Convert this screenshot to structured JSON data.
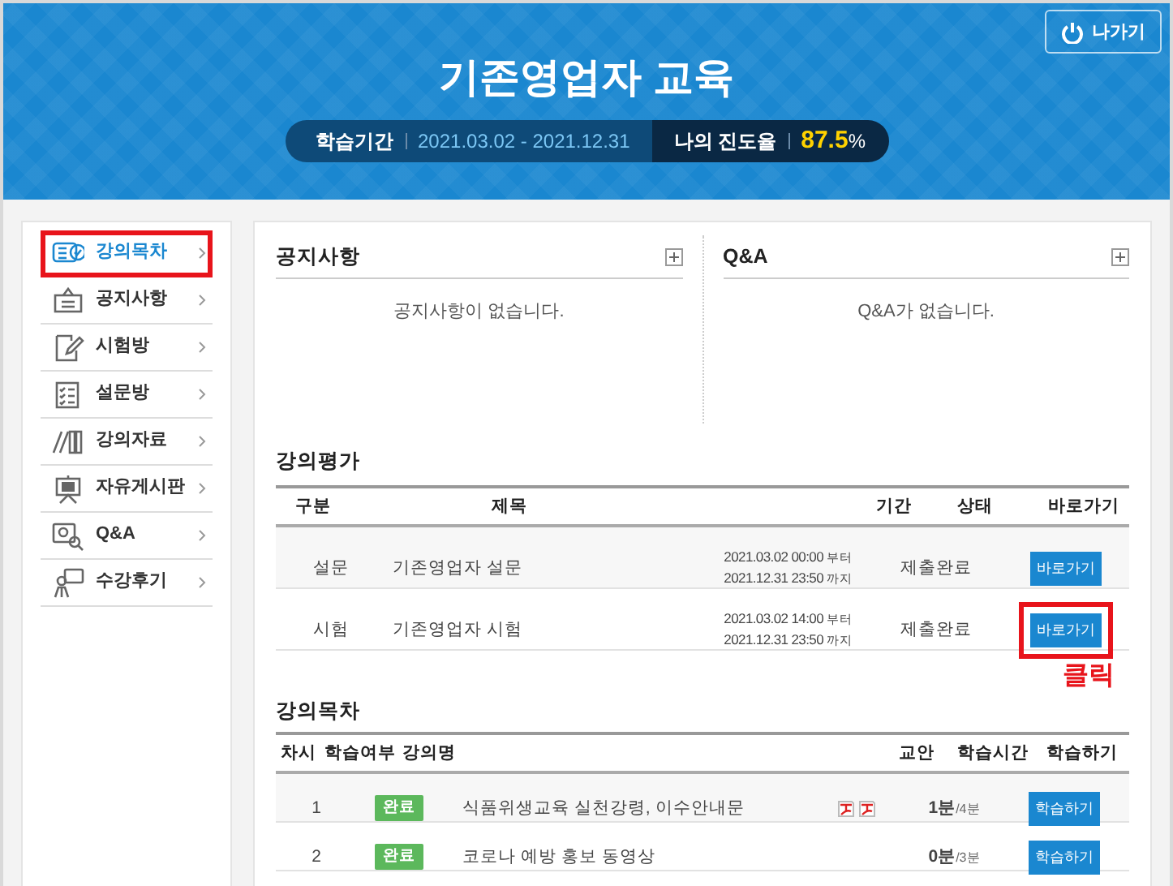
{
  "header": {
    "title": "기존영업자 교육",
    "exit_button": "나가기",
    "period_label": "학습기간",
    "period": "2021.03.02 - 2021.12.31",
    "progress_label": "나의 진도율",
    "progress_value": "87.5",
    "progress_unit": "%"
  },
  "sidebar": {
    "items": [
      {
        "label": "강의목차",
        "kind": "lecture",
        "selected": true,
        "highlighted": true
      },
      {
        "label": "공지사항",
        "kind": "notice",
        "selected": false,
        "highlighted": false
      },
      {
        "label": "시험방",
        "kind": "exam",
        "selected": false,
        "highlighted": false
      },
      {
        "label": "설문방",
        "kind": "survey",
        "selected": false,
        "highlighted": false
      },
      {
        "label": "강의자료",
        "kind": "books",
        "selected": false,
        "highlighted": false
      },
      {
        "label": "자유게시판",
        "kind": "board",
        "selected": false,
        "highlighted": false
      },
      {
        "label": "Q&A",
        "kind": "qna",
        "selected": false,
        "highlighted": false
      },
      {
        "label": "수강후기",
        "kind": "review",
        "selected": false,
        "highlighted": false
      }
    ]
  },
  "panels": [
    {
      "title": "공지사항",
      "empty_text": "공지사항이 없습니다."
    },
    {
      "title": "Q&A",
      "empty_text": "Q&A가 없습니다."
    }
  ],
  "evaluation": {
    "title": "강의평가",
    "columns": [
      "구분",
      "제목",
      "기간",
      "상태",
      "바로가기"
    ],
    "rows": [
      {
        "type": "설문",
        "title": "기존영업자 설문",
        "start": "2021.03.02 00:00",
        "start_suffix": "부터",
        "end": "2021.12.31 23:50",
        "end_suffix": "까지",
        "status": "제출완료",
        "button": "바로가기",
        "highlighted": false
      },
      {
        "type": "시험",
        "title": "기존영업자 시험",
        "start": "2021.03.02 14:00",
        "start_suffix": "부터",
        "end": "2021.12.31 23:50",
        "end_suffix": "까지",
        "status": "제출완료",
        "button": "바로가기",
        "highlighted": true
      }
    ]
  },
  "annotation": "클릭",
  "lessons": {
    "title": "강의목차",
    "columns": [
      "차시",
      "학습여부",
      "강의명",
      "교안",
      "학습시간",
      "학습하기"
    ],
    "rows": [
      {
        "no": "1",
        "status": "완료",
        "title": "식품위생교육 실천강령, 이수안내문",
        "has_handouts": true,
        "time": "1분",
        "total": "/4분",
        "button": "학습하기"
      },
      {
        "no": "2",
        "status": "완료",
        "title": "코로나 예방 홍보 동영상",
        "has_handouts": false,
        "time": "0분",
        "total": "/3분",
        "button": "학습하기"
      }
    ]
  }
}
